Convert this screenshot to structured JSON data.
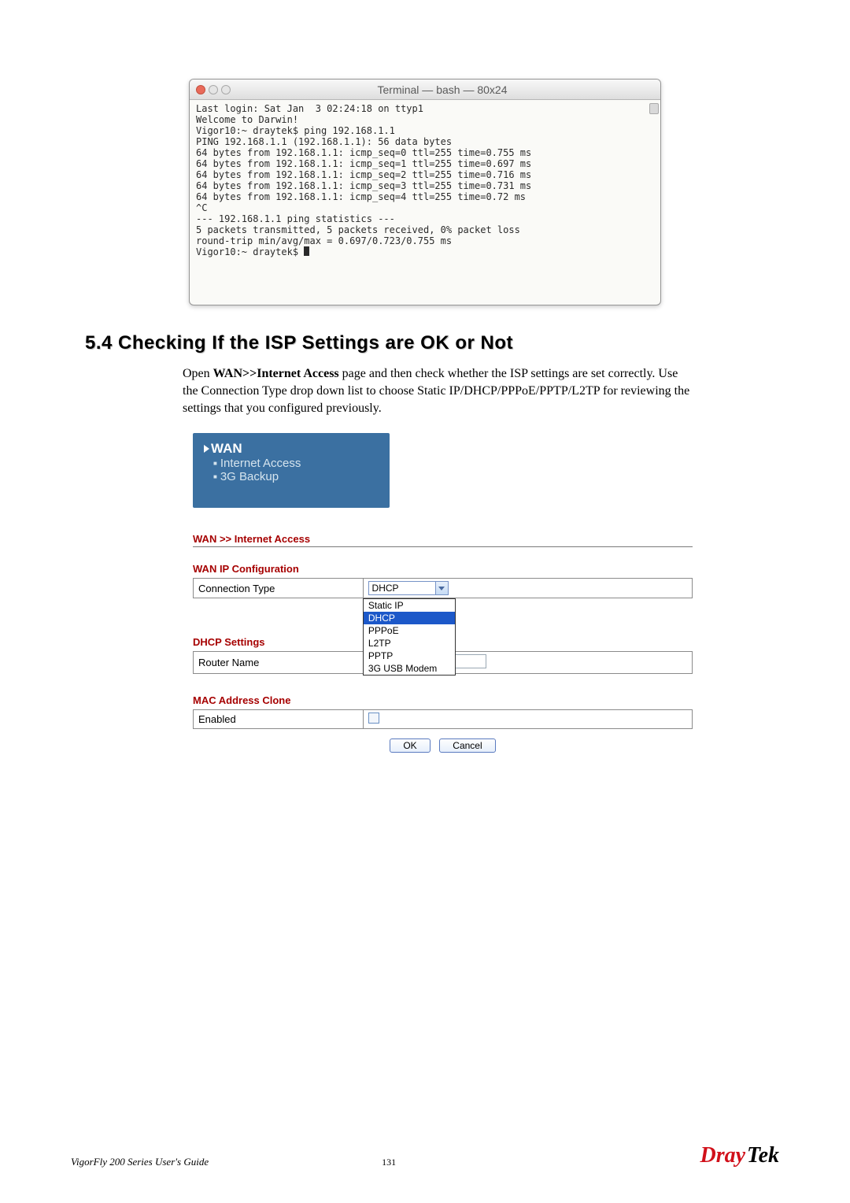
{
  "terminal": {
    "title": "Terminal — bash — 80x24",
    "lines": "Last login: Sat Jan  3 02:24:18 on ttyp1\nWelcome to Darwin!\nVigor10:~ draytek$ ping 192.168.1.1\nPING 192.168.1.1 (192.168.1.1): 56 data bytes\n64 bytes from 192.168.1.1: icmp_seq=0 ttl=255 time=0.755 ms\n64 bytes from 192.168.1.1: icmp_seq=1 ttl=255 time=0.697 ms\n64 bytes from 192.168.1.1: icmp_seq=2 ttl=255 time=0.716 ms\n64 bytes from 192.168.1.1: icmp_seq=3 ttl=255 time=0.731 ms\n64 bytes from 192.168.1.1: icmp_seq=4 ttl=255 time=0.72 ms\n^C\n--- 192.168.1.1 ping statistics ---\n5 packets transmitted, 5 packets received, 0% packet loss\nround-trip min/avg/max = 0.697/0.723/0.755 ms\nVigor10:~ draytek$ "
  },
  "heading": "5.4 Checking If the ISP Settings are OK or Not",
  "body": {
    "prefix": "Open ",
    "bold": "WAN>>Internet Access",
    "suffix": " page and then check whether the ISP settings are set correctly. Use the Connection Type drop down list to choose Static IP/DHCP/PPPoE/PPTP/L2TP for reviewing the settings that you configured previously."
  },
  "wan_nav": {
    "title": "WAN",
    "items": [
      "Internet Access",
      "3G Backup"
    ]
  },
  "config": {
    "breadcrumb": "WAN >> Internet Access",
    "wan_ip_heading": "WAN IP Configuration",
    "conn_type_label": "Connection Type",
    "conn_type_value": "DHCP",
    "conn_type_options": [
      "Static IP",
      "DHCP",
      "PPPoE",
      "L2TP",
      "PPTP",
      "3G USB Modem"
    ],
    "dhcp_heading": "DHCP Settings",
    "router_name_label": "Router Name",
    "mac_heading": "MAC Address Clone",
    "enabled_label": "Enabled",
    "ok_label": "OK",
    "cancel_label": "Cancel"
  },
  "footer": {
    "guide": "VigorFly 200 Series User's Guide",
    "page": "131",
    "brand_a": "Dray",
    "brand_b": "Tek"
  }
}
